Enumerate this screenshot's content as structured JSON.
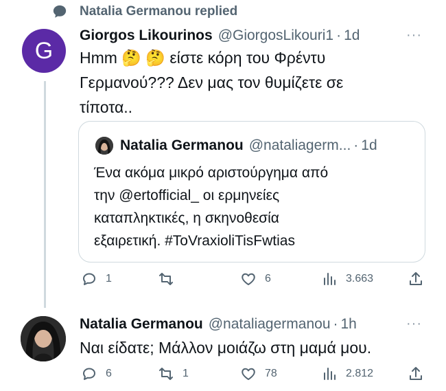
{
  "context": {
    "label": "Natalia Germanou replied",
    "icon": "speech-bubble-icon"
  },
  "reply_tweet": {
    "author_name": "Giorgos Likourinos",
    "author_handle": "@GiorgosLikouri1",
    "time": "1d",
    "avatar_letter": "G",
    "avatar_color": "#5b2aa6",
    "text_line1": "Hmm 🤔 🤔 είστε κόρη του Φρέντυ",
    "text_line2": "Γερμανού??? Δεν μας τον θυμίζετε σε",
    "text_line3": "τίποτα..",
    "more": "···",
    "quote": {
      "author_name": "Natalia Germanou",
      "author_handle": "@nataliagerm...",
      "time": "1d",
      "line1": "Ένα ακόμα μικρό αριστούργημα από",
      "line2": "την @ertofficial_ οι ερμηνείες",
      "line3": "καταπληκτικές, η σκηνοθεσία",
      "line4": "εξαιρετική.  #ToVraxioliTisFwtias"
    },
    "stats": {
      "replies": "1",
      "retweets": "",
      "likes": "6",
      "views": "3.663"
    }
  },
  "response_tweet": {
    "author_name": "Natalia Germanou",
    "author_handle": "@nataliagermanou",
    "time": "1h",
    "text": "Ναι είδατε; Μάλλον μοιάζω στη μαμά μου.",
    "more": "···",
    "stats": {
      "replies": "6",
      "retweets": "1",
      "likes": "78",
      "views": "2.812"
    }
  },
  "separator": "·"
}
